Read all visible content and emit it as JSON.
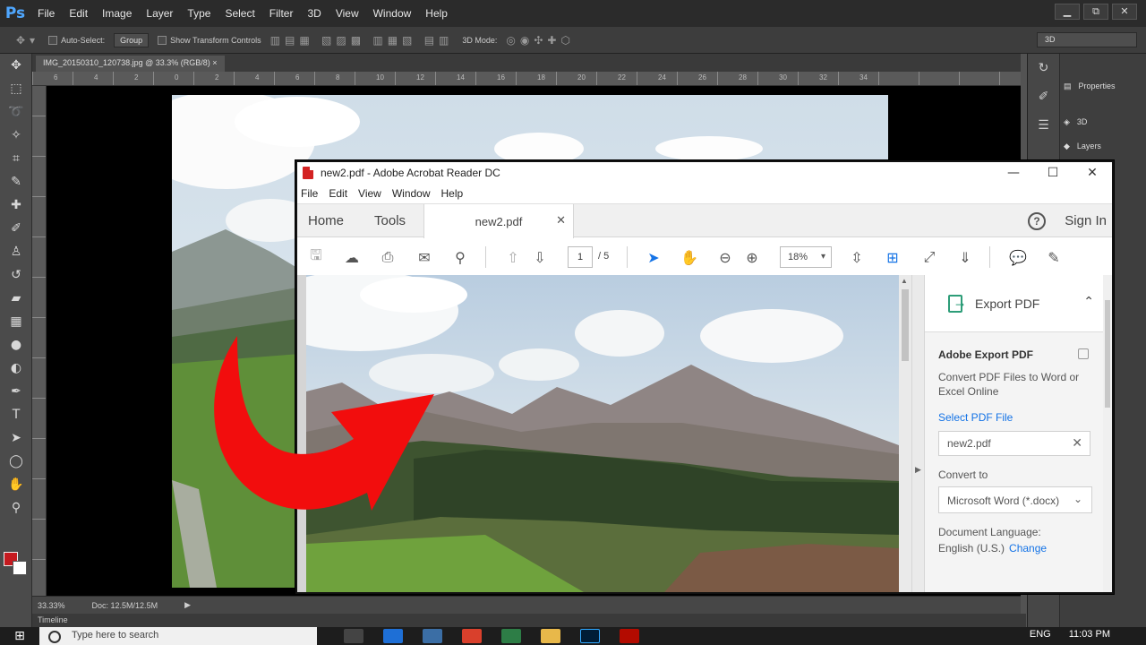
{
  "photoshop": {
    "logo": "Ps",
    "menu": [
      "File",
      "Edit",
      "Image",
      "Layer",
      "Type",
      "Select",
      "Filter",
      "3D",
      "View",
      "Window",
      "Help"
    ],
    "window_controls": [
      "▁",
      "⧉",
      "✕"
    ],
    "options": {
      "auto_select_label": "Auto-Select:",
      "auto_select_value": "Group",
      "show_transform_label": "Show Transform Controls",
      "mode_label": "3D Mode:",
      "workspace_value": "3D"
    },
    "document_tab": "IMG_20150310_120738.jpg @ 33.3% (RGB/8)",
    "ruler_ticks": [
      "6",
      "4",
      "2",
      "0",
      "2",
      "4",
      "6",
      "8",
      "10",
      "12",
      "14",
      "16",
      "18",
      "20",
      "22",
      "24",
      "26",
      "28",
      "30",
      "32",
      "34"
    ],
    "zoom_status": "33.33%",
    "doc_status": "Doc: 12.5M/12.5M",
    "timeline_label": "Timeline",
    "panels": [
      {
        "icon": "properties-icon",
        "label": "Properties"
      },
      {
        "icon": "cube-icon",
        "label": "3D"
      },
      {
        "icon": "layers-icon",
        "label": "Layers"
      }
    ],
    "colors": {
      "foreground": "#c51a1f",
      "background": "#ffffff"
    }
  },
  "taskbar": {
    "search_placeholder": "Type here to search",
    "language": "ENG",
    "time": "11:03 PM"
  },
  "acrobat": {
    "title": "new2.pdf - Adobe Acrobat Reader DC",
    "window_controls": [
      "—",
      "☐",
      "✕"
    ],
    "menu": [
      "File",
      "Edit",
      "View",
      "Window",
      "Help"
    ],
    "nav": {
      "home": "Home",
      "tools": "Tools"
    },
    "doc_tab": "new2.pdf",
    "help_glyph": "?",
    "sign_in": "Sign In",
    "toolbar": {
      "current_page": "1",
      "page_total": "/ 5",
      "zoom": "18%"
    },
    "export": {
      "header": "Export PDF",
      "title": "Adobe Export PDF",
      "description": "Convert PDF Files to Word or Excel Online",
      "select_file_link": "Select PDF File",
      "file_name": "new2.pdf",
      "convert_to_label": "Convert to",
      "convert_to_value": "Microsoft Word (*.docx)",
      "language_label": "Document Language:",
      "language_value": "English (U.S.)",
      "change_link": "Change"
    },
    "accent_color": "#1473e6"
  }
}
